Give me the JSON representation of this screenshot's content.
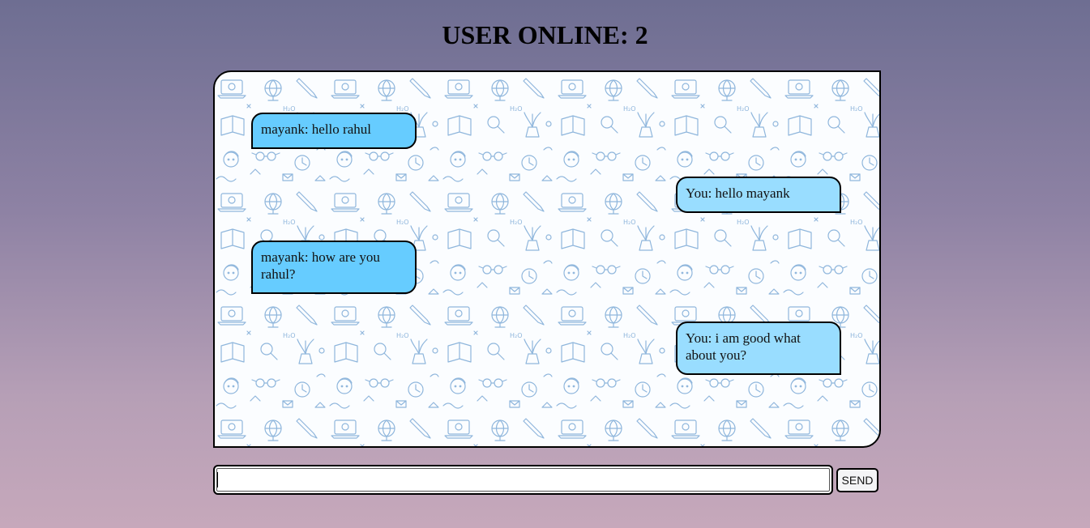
{
  "header": {
    "title": "USER ONLINE: 2"
  },
  "chat": {
    "background_pattern": "school-doodles",
    "accent_incoming": "#66ccff",
    "accent_outgoing": "#99ddff",
    "messages": [
      {
        "sender": "mayank",
        "direction": "incoming",
        "text": "mayank: hello rahul"
      },
      {
        "sender": "You",
        "direction": "outgoing",
        "text": "You: hello mayank"
      },
      {
        "sender": "mayank",
        "direction": "incoming",
        "text": "mayank: how are you rahul?"
      },
      {
        "sender": "You",
        "direction": "outgoing",
        "text": "You: i am good what about you?"
      }
    ]
  },
  "composer": {
    "input_value": "",
    "send_label": "SEND"
  }
}
